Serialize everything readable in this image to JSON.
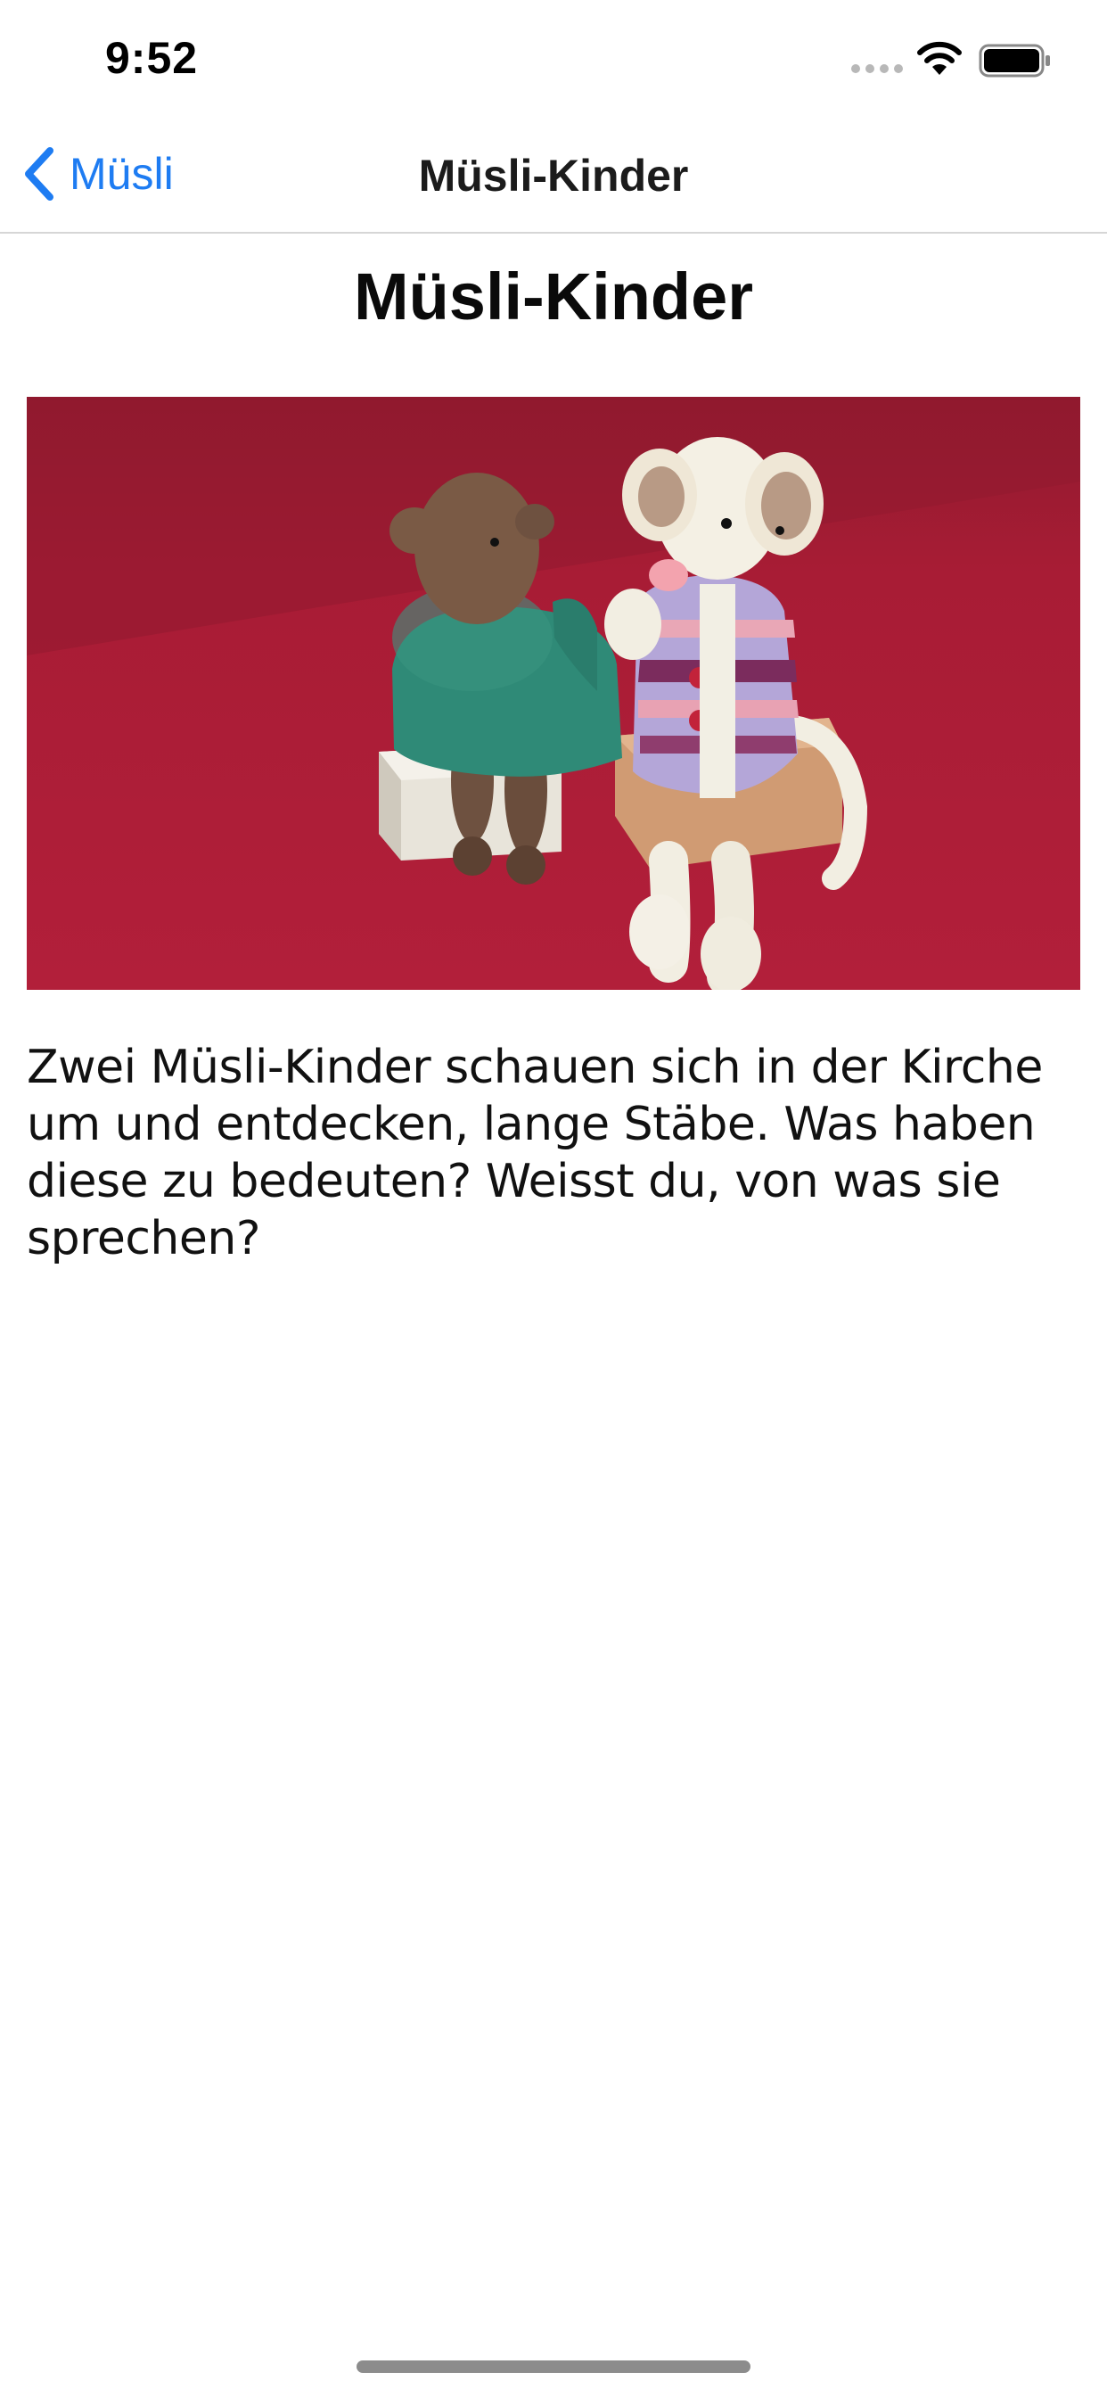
{
  "status_bar": {
    "time": "9:52"
  },
  "nav": {
    "back_label": "Müsli",
    "title": "Müsli-Kinder"
  },
  "content": {
    "title": "Müsli-Kinder",
    "description": "Zwei Müsli-Kinder schauen sich in der Kirche um und entdecken, lange Stäbe. Was haben diese zu bedeuten? Weisst du, von was sie sprechen?"
  },
  "icons": {
    "back": "chevron-left-icon",
    "wifi": "wifi-icon",
    "battery": "battery-icon",
    "signal": "cellular-signal-icon"
  },
  "colors": {
    "accent": "#1e7cf2",
    "photo_background": "#b01c36"
  }
}
